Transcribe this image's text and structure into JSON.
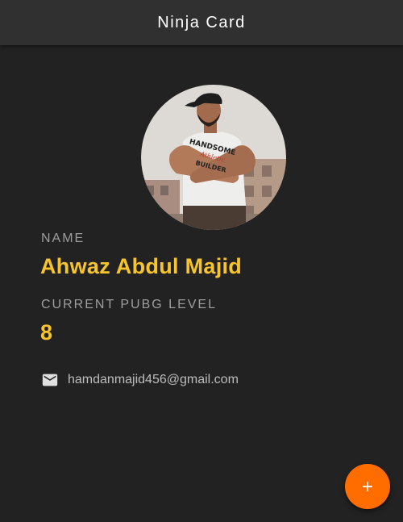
{
  "appbar": {
    "title": "Ninja Card"
  },
  "profile": {
    "avatar_description": "profile-photo",
    "name_label": "NAME",
    "name_value": "Ahwaz Abdul Majid",
    "level_label": "CURRENT PUBG LEVEL",
    "level_value": "8",
    "email": "hamdanmajid456@gmail.com",
    "email_icon": "mail-icon",
    "shirt_text": "HANDSOME Athletic BUILDER"
  },
  "fab": {
    "icon": "add-icon"
  },
  "colors": {
    "background": "#222222",
    "appbar": "#303030",
    "accent": "#f7c52b",
    "label": "#9e9e9e",
    "fab": "#ff6d00"
  }
}
